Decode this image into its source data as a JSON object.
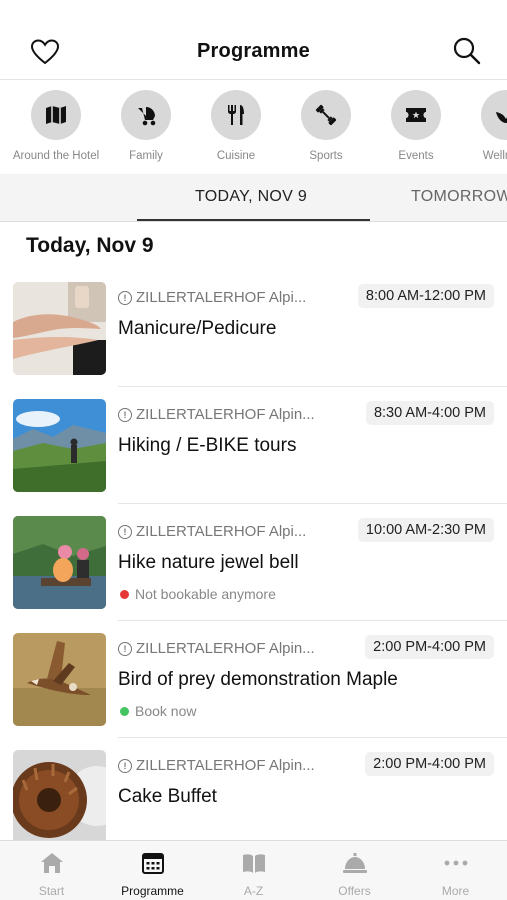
{
  "header": {
    "title": "Programme",
    "left_icon": "heart-icon",
    "right_icon": "search-icon"
  },
  "categories": [
    {
      "label": "Around the Hotel",
      "icon": "map-icon"
    },
    {
      "label": "Family",
      "icon": "stroller-icon"
    },
    {
      "label": "Cuisine",
      "icon": "cutlery-icon"
    },
    {
      "label": "Sports",
      "icon": "dumbbell-icon"
    },
    {
      "label": "Events",
      "icon": "ticket-icon"
    },
    {
      "label": "Wellness",
      "icon": "wellness-icon"
    }
  ],
  "day_tabs": [
    {
      "label": "TODAY, NOV 9",
      "active": true
    },
    {
      "label": "TOMORROW",
      "active": false
    }
  ],
  "section_title": "Today, Nov 9",
  "events": [
    {
      "location": "ZILLERTALERHOF Alpi...",
      "time": "8:00 AM-12:00 PM",
      "name": "Manicure/Pedicure",
      "status": "",
      "status_color": ""
    },
    {
      "location": "ZILLERTALERHOF Alpin...",
      "time": "8:30 AM-4:00 PM",
      "name": "Hiking / E-BIKE tours",
      "status": "",
      "status_color": ""
    },
    {
      "location": "ZILLERTALERHOF Alpi...",
      "time": "10:00 AM-2:30 PM",
      "name": "Hike nature jewel bell",
      "status": "Not bookable anymore",
      "status_color": "#e53935"
    },
    {
      "location": "ZILLERTALERHOF Alpin...",
      "time": "2:00 PM-4:00 PM",
      "name": "Bird of prey demonstration Maple",
      "status": "Book now",
      "status_color": "#43c463"
    },
    {
      "location": "ZILLERTALERHOF Alpin...",
      "time": "2:00 PM-4:00 PM",
      "name": "Cake Buffet",
      "status": "",
      "status_color": ""
    }
  ],
  "tabbar": [
    {
      "label": "Start",
      "icon": "home-icon",
      "active": false
    },
    {
      "label": "Programme",
      "icon": "calendar-icon",
      "active": true
    },
    {
      "label": "A-Z",
      "icon": "book-icon",
      "active": false
    },
    {
      "label": "Offers",
      "icon": "service-bell-icon",
      "active": false
    },
    {
      "label": "More",
      "icon": "more-icon",
      "active": false
    }
  ]
}
